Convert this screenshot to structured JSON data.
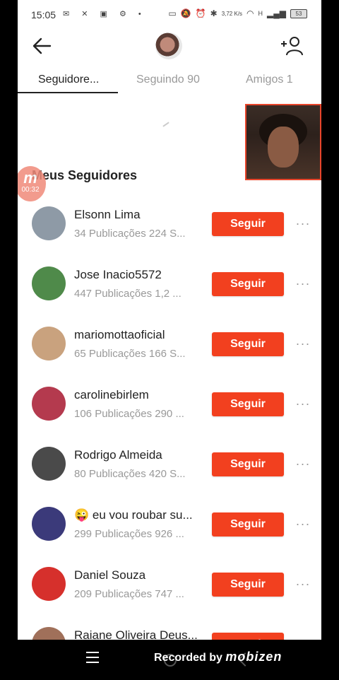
{
  "status_bar": {
    "time": "15:05",
    "left_icons": [
      "notification",
      "notification",
      "notification",
      "notification",
      "dot"
    ],
    "network_speed": "3,72 K/s",
    "network_type": "H",
    "battery": "53"
  },
  "header": {
    "back_icon": "arrow-left-icon",
    "add_user_icon": "add-user-icon"
  },
  "tabs": [
    {
      "label": "Seguidore...",
      "active": true
    },
    {
      "label": "Seguindo 90",
      "active": false
    },
    {
      "label": "Amigos 1",
      "active": false
    }
  ],
  "recording_badge": {
    "time": "00:32"
  },
  "section": {
    "title": "Meus Seguidores"
  },
  "followers": [
    {
      "name": "Elsonn Lima",
      "stats": "34 Publicações 224 S...",
      "button": "Seguir",
      "avatar_color": "#8e9aa6"
    },
    {
      "name": "Jose Inacio5572",
      "stats": "447 Publicações 1,2 ...",
      "button": "Seguir",
      "avatar_color": "#4f8a4a"
    },
    {
      "name": "mariomottaoficial",
      "stats": "65 Publicações 166 S...",
      "button": "Seguir",
      "avatar_color": "#c9a27e"
    },
    {
      "name": "carolinebirlem",
      "stats": "106 Publicações 290 ...",
      "button": "Seguir",
      "avatar_color": "#b43a4e"
    },
    {
      "name": "Rodrigo Almeida",
      "stats": "80 Publicações 420 S...",
      "button": "Seguir",
      "avatar_color": "#4a4a4a"
    },
    {
      "name": "😜 eu vou roubar su...",
      "stats": "299 Publicações 926 ...",
      "button": "Seguir",
      "avatar_color": "#3b3a7a"
    },
    {
      "name": "Daniel Souza",
      "stats": "209 Publicações 747 ...",
      "button": "Seguir",
      "avatar_color": "#d6302c"
    },
    {
      "name": "Raiane Oliveira Deus...",
      "stats": "",
      "button": "Seguir",
      "avatar_color": "#a0705a"
    }
  ],
  "more_label": "···",
  "pip": {
    "description_icon": "camera-preview"
  },
  "recorder": {
    "text": "Recorded by",
    "brand": "mobizen"
  },
  "colors": {
    "accent": "#f2401f",
    "pip_border": "#e8452b"
  }
}
